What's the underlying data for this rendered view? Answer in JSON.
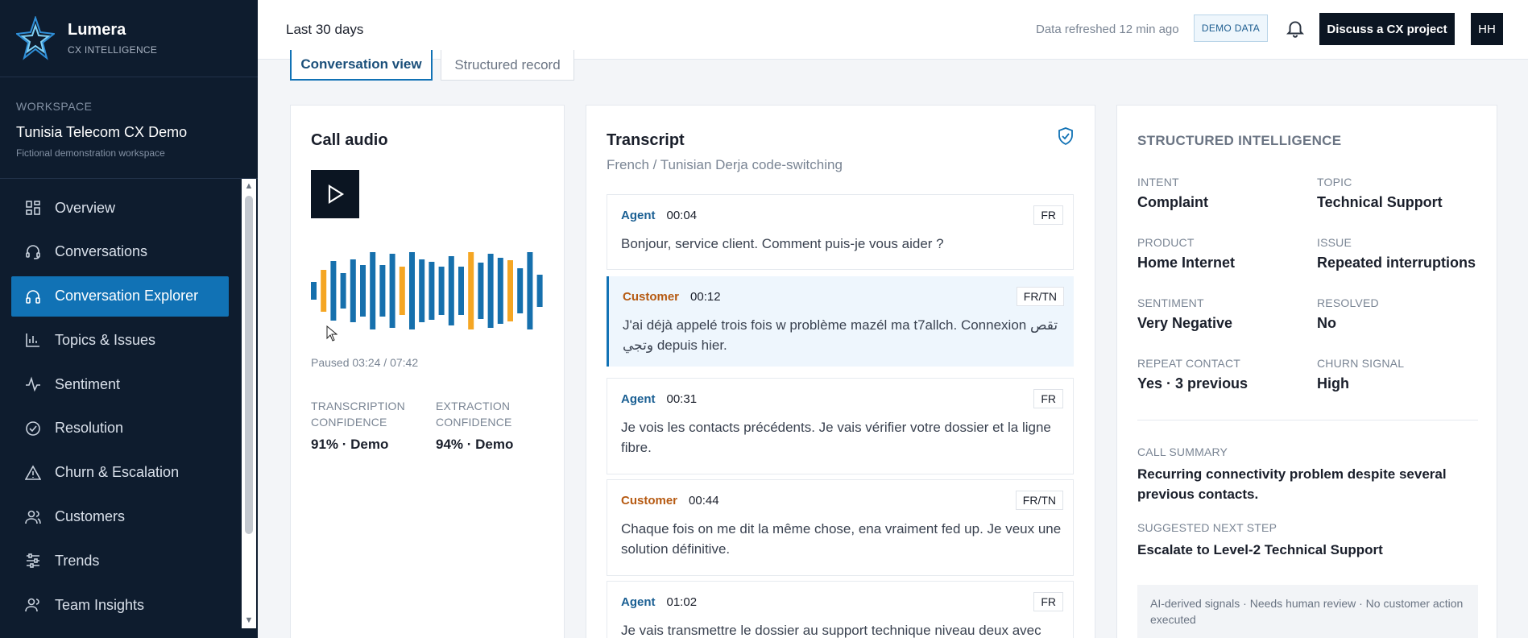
{
  "brand": {
    "name": "Lumera",
    "subtitle": "CX INTELLIGENCE"
  },
  "workspace": {
    "label": "WORKSPACE",
    "name": "Tunisia Telecom CX Demo",
    "note": "Fictional demonstration workspace"
  },
  "nav": [
    {
      "label": "Overview",
      "icon": "grid-icon"
    },
    {
      "label": "Conversations",
      "icon": "headset-icon"
    },
    {
      "label": "Conversation Explorer",
      "icon": "headphones-icon",
      "active": true
    },
    {
      "label": "Topics & Issues",
      "icon": "bar-chart-icon"
    },
    {
      "label": "Sentiment",
      "icon": "pulse-icon"
    },
    {
      "label": "Resolution",
      "icon": "check-circle-icon"
    },
    {
      "label": "Churn & Escalation",
      "icon": "warning-icon"
    },
    {
      "label": "Customers",
      "icon": "users-icon"
    },
    {
      "label": "Trends",
      "icon": "sliders-icon"
    },
    {
      "label": "Team Insights",
      "icon": "team-icon"
    }
  ],
  "topbar": {
    "period": "Last 30 days",
    "refresh": "Data refreshed 12 min ago",
    "badge": "DEMO DATA",
    "cta": "Discuss a CX project",
    "avatar": "HH"
  },
  "tabs": {
    "conversation": "Conversation view",
    "structured": "Structured record"
  },
  "audio": {
    "title": "Call audio",
    "status": "Paused 03:24 / 07:42",
    "transcription_label": "TRANSCRIPTION CONFIDENCE",
    "transcription_value": "91% · Demo",
    "extraction_label": "EXTRACTION CONFIDENCE",
    "extraction_value": "94% · Demo"
  },
  "transcript": {
    "title": "Transcript",
    "subtitle": "French / Tunisian Derja code-switching",
    "messages": [
      {
        "role": "Agent",
        "time": "00:04",
        "lang": "FR",
        "text": "Bonjour, service client. Comment puis-je vous aider ?"
      },
      {
        "role": "Customer",
        "time": "00:12",
        "lang": "FR/TN",
        "text": "J'ai déjà appelé trois fois w problème mazél ma t7allch. Connexion تقص وتجي depuis hier."
      },
      {
        "role": "Agent",
        "time": "00:31",
        "lang": "FR",
        "text": "Je vois les contacts précédents. Je vais vérifier votre dossier et la ligne fibre."
      },
      {
        "role": "Customer",
        "time": "00:44",
        "lang": "FR/TN",
        "text": "Chaque fois on me dit la même chose, ena vraiment fed up. Je veux une solution définitive."
      },
      {
        "role": "Agent",
        "time": "01:02",
        "lang": "FR",
        "text": "Je vais transmettre le dossier au support technique niveau deux avec"
      }
    ]
  },
  "structured": {
    "title": "STRUCTURED INTELLIGENCE",
    "fields": [
      {
        "label": "INTENT",
        "value": "Complaint"
      },
      {
        "label": "TOPIC",
        "value": "Technical Support"
      },
      {
        "label": "PRODUCT",
        "value": "Home Internet"
      },
      {
        "label": "ISSUE",
        "value": "Repeated interruptions"
      },
      {
        "label": "SENTIMENT",
        "value": "Very Negative"
      },
      {
        "label": "RESOLVED",
        "value": "No"
      },
      {
        "label": "REPEAT CONTACT",
        "value": "Yes · 3 previous"
      },
      {
        "label": "CHURN SIGNAL",
        "value": "High"
      }
    ],
    "summary_label": "CALL SUMMARY",
    "summary_value": "Recurring connectivity problem despite several previous contacts.",
    "next_label": "SUGGESTED NEXT STEP",
    "next_value": "Escalate to Level-2 Technical Support",
    "note": "AI-derived signals · Needs human review · No customer action executed"
  },
  "colors": {
    "sidebar": "#0e1c2e",
    "accent": "#1172b5",
    "wave_blue": "#1670ad",
    "wave_orange": "#f5a623",
    "customer": "#b65a12"
  }
}
